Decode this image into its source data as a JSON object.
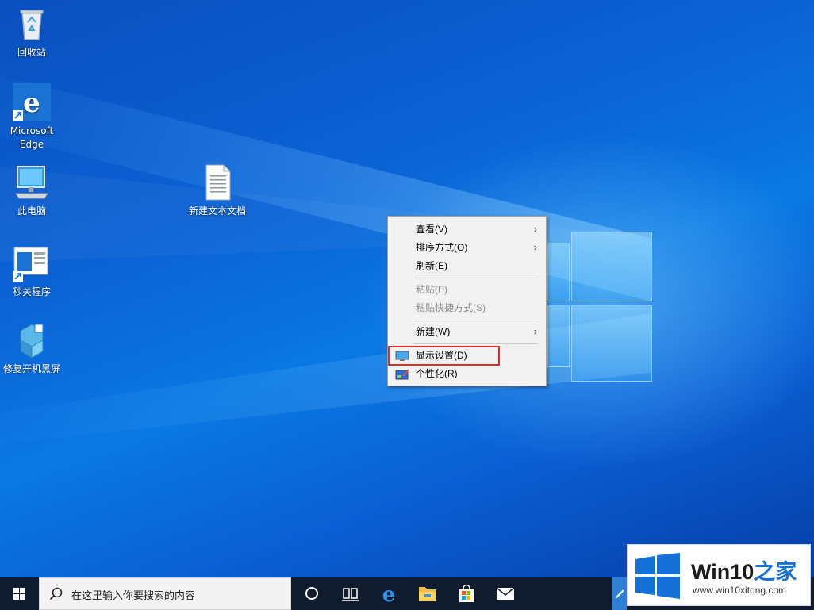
{
  "desktop": {
    "icons": [
      {
        "label": "回收站",
        "icon": "recycle-bin-icon"
      },
      {
        "label": "Microsoft Edge",
        "icon": "edge-icon"
      },
      {
        "label": "此电脑",
        "icon": "computer-icon"
      },
      {
        "label": "秒关程序",
        "icon": "program-shortcut-icon"
      },
      {
        "label": "修复开机黑屏",
        "icon": "repair-tool-icon"
      },
      {
        "label": "新建文本文档",
        "icon": "text-document-icon"
      }
    ]
  },
  "context_menu": {
    "items": [
      {
        "label": "查看(V)",
        "submenu": true,
        "enabled": true
      },
      {
        "label": "排序方式(O)",
        "submenu": true,
        "enabled": true
      },
      {
        "label": "刷新(E)",
        "submenu": false,
        "enabled": true
      },
      {
        "label": "粘贴(P)",
        "submenu": false,
        "enabled": false
      },
      {
        "label": "粘贴快捷方式(S)",
        "submenu": false,
        "enabled": false
      },
      {
        "label": "新建(W)",
        "submenu": true,
        "enabled": true
      },
      {
        "label": "显示设置(D)",
        "submenu": false,
        "enabled": true,
        "icon": "display-icon",
        "highlighted": true
      },
      {
        "label": "个性化(R)",
        "submenu": false,
        "enabled": true,
        "icon": "personalize-icon"
      }
    ],
    "submenu_arrow": "›"
  },
  "taskbar": {
    "search_placeholder": "在这里输入你要搜索的内容",
    "buttons": [
      "cortana-icon",
      "task-view-icon",
      "edge-icon",
      "file-explorer-icon",
      "store-icon",
      "mail-icon"
    ]
  },
  "watermark": {
    "title_prefix": "Win10",
    "title_suffix": "之家",
    "url": "www.win10xitong.com"
  },
  "colors": {
    "wallpaper": "#0a5fd0",
    "taskbar": "#101c2e",
    "highlight_border": "#e02b2b",
    "menu_bg": "#f2f2f2"
  }
}
